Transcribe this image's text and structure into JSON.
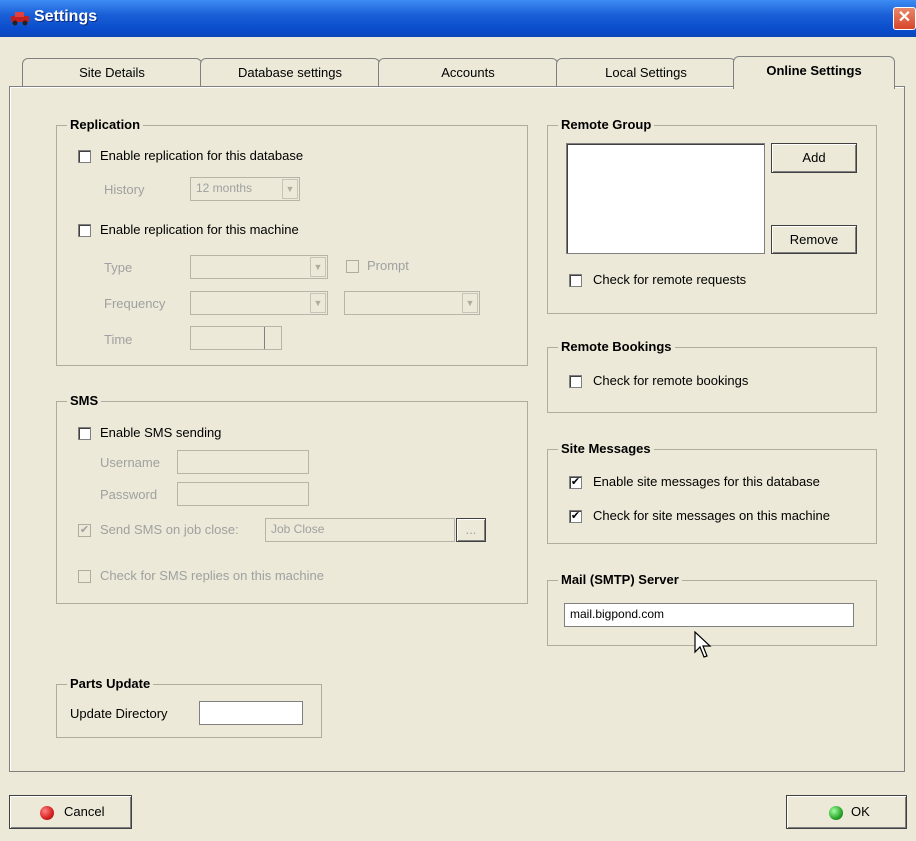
{
  "window": {
    "title": "Settings",
    "close_glyph": "✕",
    "icon": "car-icon"
  },
  "tabs": [
    {
      "label": "Site Details"
    },
    {
      "label": "Database settings"
    },
    {
      "label": "Accounts"
    },
    {
      "label": "Local Settings"
    },
    {
      "label": "Online Settings",
      "active": true
    }
  ],
  "replication": {
    "legend": "Replication",
    "enable_db_label": "Enable replication for this database",
    "history_label": "History",
    "history_value": "12 months",
    "enable_machine_label": "Enable replication for this machine",
    "type_label": "Type",
    "prompt_label": "Prompt",
    "frequency_label": "Frequency",
    "time_label": "Time"
  },
  "sms": {
    "legend": "SMS",
    "enable_label": "Enable SMS sending",
    "username_label": "Username",
    "password_label": "Password",
    "send_on_close_label": "Send SMS on job close:",
    "send_on_close_value": "Job Close",
    "browse_label": "...",
    "check_replies_label": "Check for SMS replies on this machine"
  },
  "parts_update": {
    "legend": "Parts Update",
    "directory_label": "Update Directory",
    "directory_value": ""
  },
  "remote_group": {
    "legend": "Remote Group",
    "add_label": "Add",
    "remove_label": "Remove",
    "check_requests_label": "Check for remote requests"
  },
  "remote_bookings": {
    "legend": "Remote Bookings",
    "check_label": "Check for remote bookings"
  },
  "site_messages": {
    "legend": "Site Messages",
    "enable_db_label": "Enable site messages for this database",
    "enable_db_checked": true,
    "check_machine_label": "Check for site messages on this machine",
    "check_machine_checked": true
  },
  "mail_server": {
    "legend": "Mail (SMTP) Server",
    "value": "mail.bigpond.com"
  },
  "buttons": {
    "cancel_label": "Cancel",
    "ok_label": "OK",
    "cancel_color": "#d42020",
    "ok_color": "#2aa52a"
  },
  "check_glyph": "✔"
}
